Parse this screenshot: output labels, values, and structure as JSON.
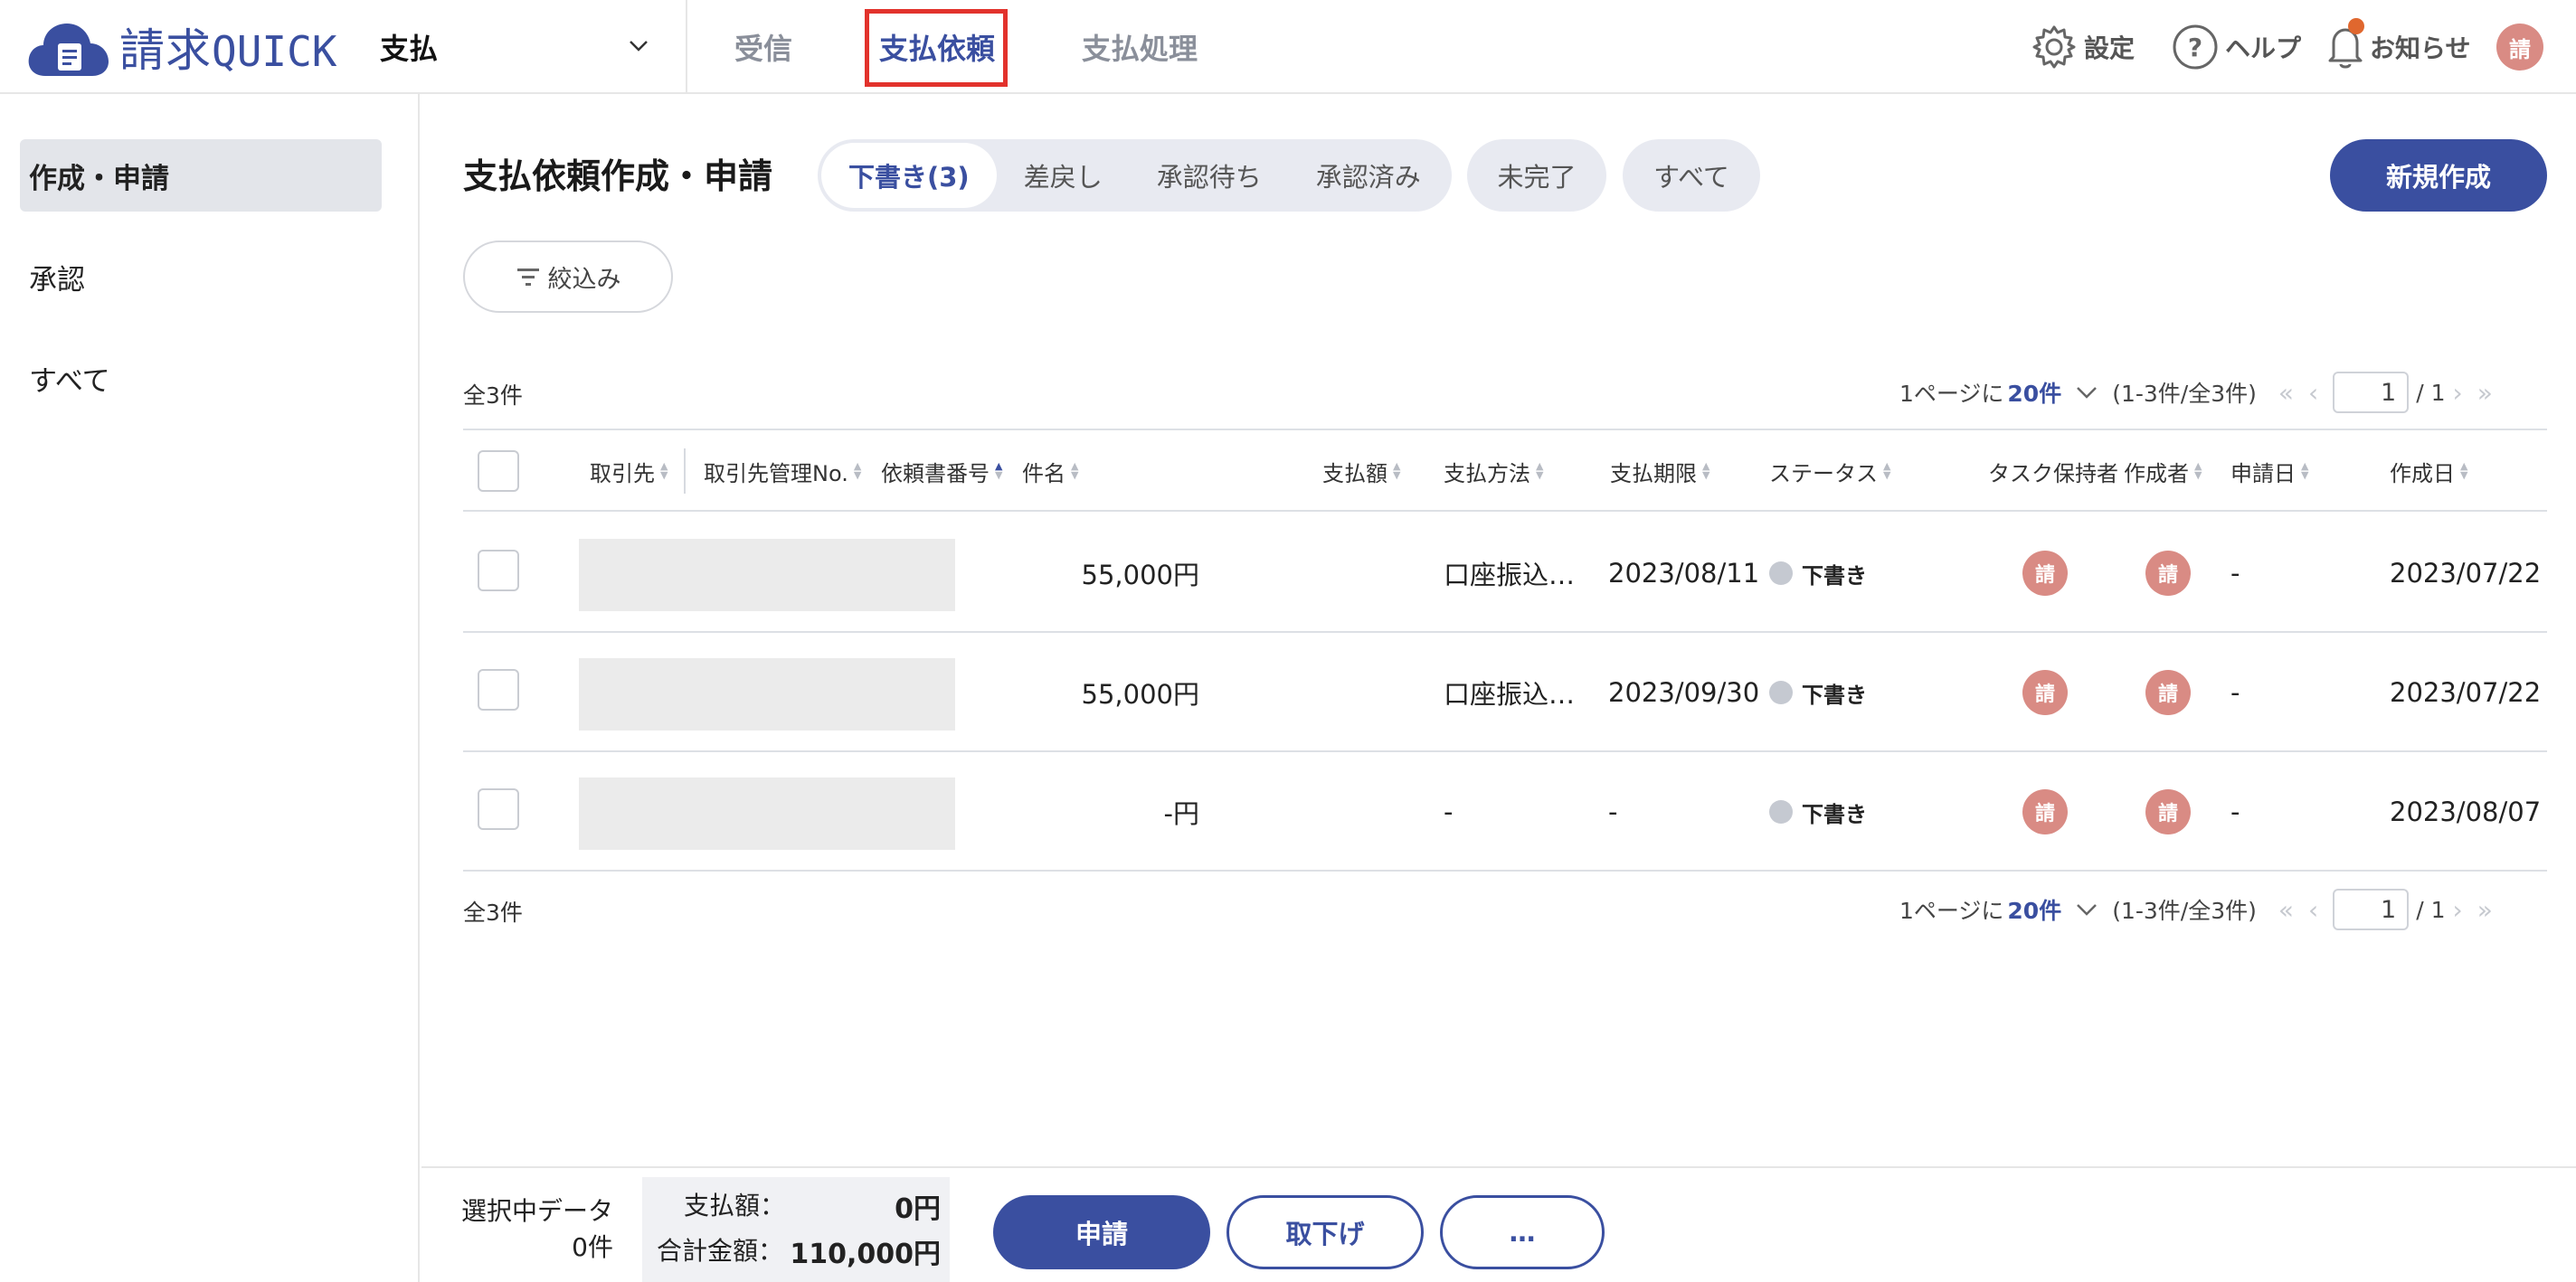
{
  "app": {
    "logo_text_1": "請求",
    "logo_text_2": "QUICK",
    "module": "支払"
  },
  "top_nav": {
    "tabs": [
      "受信",
      "支払依頼",
      "支払処理"
    ],
    "active": "支払依頼"
  },
  "header_right": {
    "settings": "設定",
    "help": "ヘルプ",
    "notifications": "お知らせ",
    "avatar": "請"
  },
  "sidebar": {
    "items": [
      "作成・申請",
      "承認",
      "すべて"
    ],
    "active": "作成・申請"
  },
  "page": {
    "title": "支払依頼作成・申請",
    "status_tabs": [
      "下書き(3)",
      "差戻し",
      "承認待ち",
      "承認済み"
    ],
    "extra_pills": [
      "未完了",
      "すべて"
    ],
    "new_button": "新規作成",
    "filter_button": "絞込み"
  },
  "pagination": {
    "total": "全3件",
    "per_page_prefix": "1ページに",
    "per_page": "20件",
    "range": "(1-3件/全3件)",
    "current_page": "1",
    "total_pages": "/ 1"
  },
  "table": {
    "columns": [
      "取引先",
      "取引先管理No.",
      "依頼書番号",
      "件名",
      "支払額",
      "支払方法",
      "支払期限",
      "ステータス",
      "タスク保持者",
      "作成者",
      "申請日",
      "作成日"
    ],
    "rows": [
      {
        "amount": "55,000円",
        "method": "口座振込…",
        "due": "2023/08/11",
        "status": "下書き",
        "task_holder": "請",
        "creator": "請",
        "applied": "-",
        "created": "2023/07/22"
      },
      {
        "amount": "55,000円",
        "method": "口座振込…",
        "due": "2023/09/30",
        "status": "下書き",
        "task_holder": "請",
        "creator": "請",
        "applied": "-",
        "created": "2023/07/22"
      },
      {
        "amount": "-円",
        "method": "-",
        "due": "-",
        "status": "下書き",
        "task_holder": "請",
        "creator": "請",
        "applied": "-",
        "created": "2023/08/07"
      }
    ]
  },
  "bottom_bar": {
    "selected_label": "選択中データ",
    "selected_count": "0件",
    "payment_label": "支払額：",
    "payment_value": "0円",
    "total_label": "合計金額：",
    "total_value": "110,000円",
    "apply_button": "申請",
    "withdraw_button": "取下げ",
    "more_button": "…"
  },
  "colors": {
    "brand": "#3a4fa0",
    "active_outline": "#e2322c",
    "avatar": "#d98b84"
  }
}
